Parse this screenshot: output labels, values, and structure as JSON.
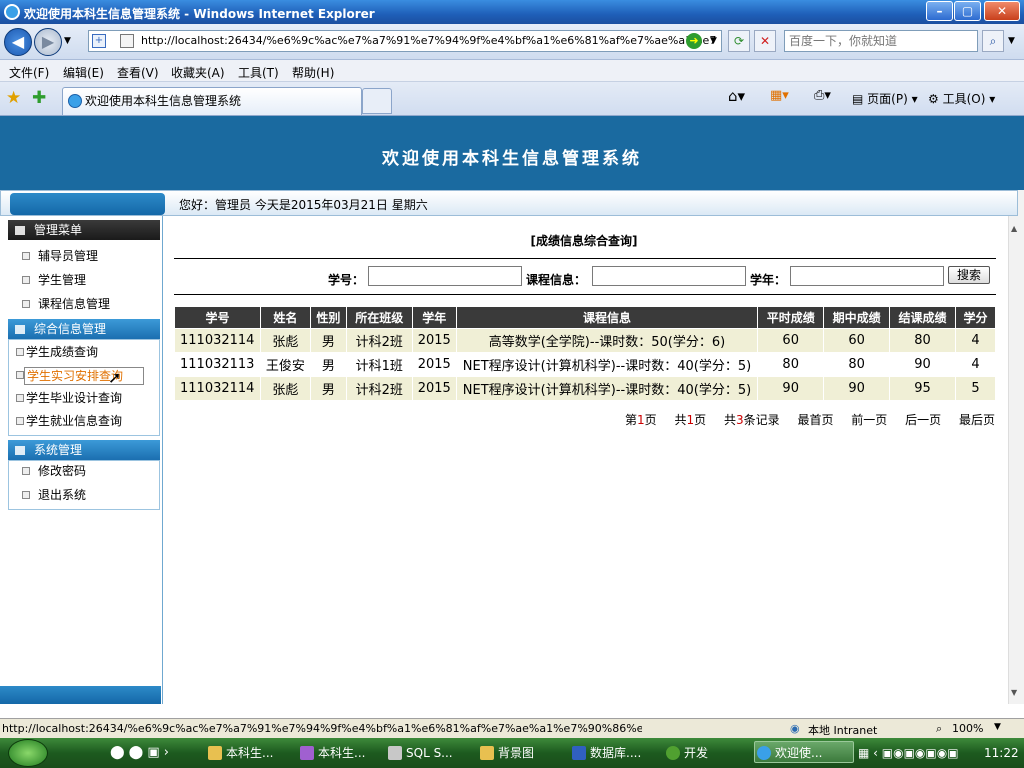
{
  "window": {
    "title": "欢迎使用本科生信息管理系统 - Windows Internet Explorer",
    "min": "–",
    "max": "▢",
    "close": "✕"
  },
  "address": {
    "url": "http://localhost:26434/%e6%9c%ac%e7%a7%91%e7%94%9f%e4%bf%a1%e6%81%af%e7%ae%a1%e7",
    "search_placeholder": "百度一下，你就知道"
  },
  "menu": [
    "文件(F)",
    "编辑(E)",
    "查看(V)",
    "收藏夹(A)",
    "工具(T)",
    "帮助(H)"
  ],
  "tab": {
    "label": "欢迎使用本科生信息管理系统",
    "page_btn": "页面(P)",
    "tools_btn": "工具(O)"
  },
  "banner": {
    "title": "欢迎使用本科生信息管理系统"
  },
  "greeting": "您好：管理员    今天是2015年03月21日    星期六",
  "sidebar": {
    "menu_title": "管理菜单",
    "group1": [
      "辅导员管理",
      "学生管理",
      "课程信息管理"
    ],
    "group2_title": "综合信息管理",
    "group2": [
      "学生成绩查询",
      "学生实习安排查询",
      "学生毕业设计查询",
      "学生就业信息查询"
    ],
    "group3_title": "系统管理",
    "group3": [
      "修改密码",
      "退出系统"
    ]
  },
  "main": {
    "title": "[成绩信息综合查询]",
    "labels": {
      "sid": "学号：",
      "course": "课程信息：",
      "year": "学年："
    },
    "search_btn": "搜索"
  },
  "chart_data": {
    "type": "table",
    "columns": [
      "学号",
      "姓名",
      "性别",
      "所在班级",
      "学年",
      "课程信息",
      "平时成绩",
      "期中成绩",
      "结课成绩",
      "学分"
    ],
    "rows": [
      [
        "111032114",
        "张彪",
        "男",
        "计科2班",
        "2015",
        "高等数学(全学院)--课时数：50(学分：6)",
        "60",
        "60",
        "80",
        "4"
      ],
      [
        "111032113",
        "王俊安",
        "男",
        "计科1班",
        "2015",
        "NET程序设计(计算机科学)--课时数：40(学分：5)",
        "80",
        "80",
        "90",
        "4"
      ],
      [
        "111032114",
        "张彪",
        "男",
        "计科2班",
        "2015",
        "NET程序设计(计算机科学)--课时数：40(学分：5)",
        "90",
        "90",
        "95",
        "5"
      ]
    ]
  },
  "pager": {
    "page_a": "第",
    "page_n": "1",
    "page_b": "页",
    "total_a": "共",
    "total_n": "1",
    "total_b": "页",
    "rec_a": "共",
    "rec_n": "3",
    "rec_b": "条记录",
    "first": "最首页",
    "prev": "前一页",
    "next": "后一页",
    "last": "最后页"
  },
  "status": {
    "url": "http://localhost:26434/%e6%9c%ac%e7%a7%91%e7%94%9f%e4%bf%a1%e6%81%af%e7%ae%a1%e7%90%86%e7%b3%bb%e",
    "zone": "本地 Intranet",
    "zoom": "100%"
  },
  "taskbar": {
    "items": [
      "本科生...",
      "本科生...",
      "SQL S...",
      "背景图",
      "数据库....",
      "开发",
      "欢迎使..."
    ],
    "clock": "11:22"
  }
}
